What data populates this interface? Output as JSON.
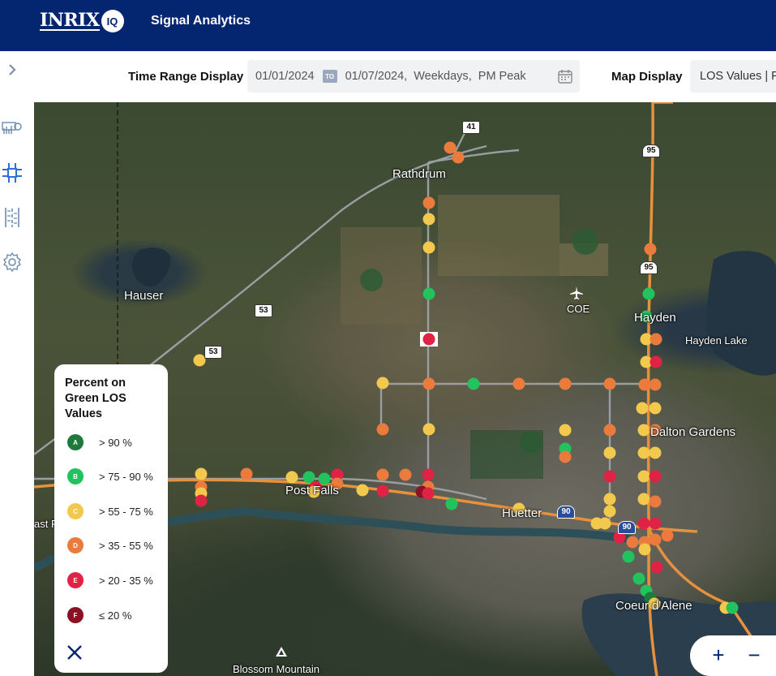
{
  "header": {
    "logo_text": "INRIX",
    "logo_badge": "IQ",
    "app_title": "Signal Analytics"
  },
  "toolbar": {
    "time_range_label": "Time Range Display",
    "start_date": "01/01/2024",
    "to_badge": "TO",
    "end_date": "01/07/2024",
    "day_type": "Weekdays",
    "period": "PM Peak",
    "map_display_label": "Map Display",
    "map_display_value": "LOS Values | Pe"
  },
  "sidebar": {
    "icons": [
      "expand-icon",
      "dashboard-icon",
      "signal-network-icon",
      "corridor-icon",
      "settings-icon"
    ]
  },
  "map": {
    "places": [
      "Rathdrum",
      "Hauser",
      "COE",
      "Hayden",
      "Hayden Lake",
      "Dalton Gardens",
      "Post Falls",
      "Huetter",
      "Coeur d'Alene",
      "Blossom Mountain",
      "ast F"
    ],
    "route_shields": [
      "41",
      "95",
      "95",
      "53",
      "53",
      "90",
      "90"
    ]
  },
  "legend": {
    "title": "Percent on Green LOS Values",
    "items": [
      {
        "grade": "A",
        "label": "> 90 %",
        "color": "#1e7a3c"
      },
      {
        "grade": "B",
        "label": "> 75 - 90 %",
        "color": "#22c35e"
      },
      {
        "grade": "C",
        "label": "> 55 - 75 %",
        "color": "#f2c94c"
      },
      {
        "grade": "D",
        "label": "> 35 - 55 %",
        "color": "#ea7b3c"
      },
      {
        "grade": "E",
        "label": "> 20 - 35 %",
        "color": "#e02245"
      },
      {
        "grade": "F",
        "label": "≤ 20 %",
        "color": "#8b1224"
      }
    ]
  },
  "zoom": {
    "in": "+",
    "out": "−"
  }
}
